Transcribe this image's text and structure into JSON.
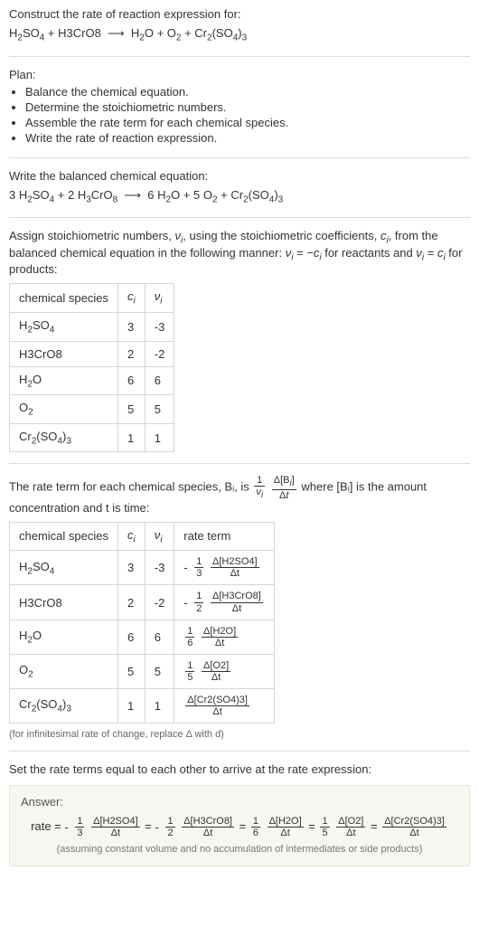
{
  "header": {
    "prompt": "Construct the rate of reaction expression for:",
    "equation": "H₂SO₄ + H3CrO8 ⟶ H₂O + O₂ + Cr₂(SO₄)₃"
  },
  "plan": {
    "title": "Plan:",
    "items": [
      "Balance the chemical equation.",
      "Determine the stoichiometric numbers.",
      "Assemble the rate term for each chemical species.",
      "Write the rate of reaction expression."
    ]
  },
  "balanced": {
    "title": "Write the balanced chemical equation:",
    "equation": "3 H₂SO₄ + 2 H₃CrO₈ ⟶ 6 H₂O + 5 O₂ + Cr₂(SO₄)₃"
  },
  "stoich_text_1": "Assign stoichiometric numbers, νᵢ, using the stoichiometric coefficients, cᵢ, from the balanced chemical equation in the following manner: νᵢ = −cᵢ for reactants and νᵢ = cᵢ for products:",
  "stoich_table": {
    "headers": [
      "chemical species",
      "cᵢ",
      "νᵢ"
    ],
    "rows": [
      {
        "species": "H₂SO₄",
        "c": "3",
        "v": "-3"
      },
      {
        "species": "H3CrO8",
        "c": "2",
        "v": "-2"
      },
      {
        "species": "H₂O",
        "c": "6",
        "v": "6"
      },
      {
        "species": "O₂",
        "c": "5",
        "v": "5"
      },
      {
        "species": "Cr₂(SO₄)₃",
        "c": "1",
        "v": "1"
      }
    ]
  },
  "rate_term_text_pre": "The rate term for each chemical species, Bᵢ, is ",
  "rate_term_text_post": " where [Bᵢ] is the amount concentration and t is time:",
  "rate_table": {
    "headers": [
      "chemical species",
      "cᵢ",
      "νᵢ",
      "rate term"
    ],
    "rows": [
      {
        "species": "H₂SO₄",
        "c": "3",
        "v": "-3",
        "sign": "-",
        "coef_num": "1",
        "coef_den": "3",
        "d_num": "Δ[H2SO4]",
        "d_den": "Δt"
      },
      {
        "species": "H3CrO8",
        "c": "2",
        "v": "-2",
        "sign": "-",
        "coef_num": "1",
        "coef_den": "2",
        "d_num": "Δ[H3CrO8]",
        "d_den": "Δt"
      },
      {
        "species": "H₂O",
        "c": "6",
        "v": "6",
        "sign": "",
        "coef_num": "1",
        "coef_den": "6",
        "d_num": "Δ[H2O]",
        "d_den": "Δt"
      },
      {
        "species": "O₂",
        "c": "5",
        "v": "5",
        "sign": "",
        "coef_num": "1",
        "coef_den": "5",
        "d_num": "Δ[O2]",
        "d_den": "Δt"
      },
      {
        "species": "Cr₂(SO₄)₃",
        "c": "1",
        "v": "1",
        "sign": "",
        "coef_num": "",
        "coef_den": "",
        "d_num": "Δ[Cr2(SO4)3]",
        "d_den": "Δt"
      }
    ],
    "footnote": "(for infinitesimal rate of change, replace Δ with d)"
  },
  "final_text": "Set the rate terms equal to each other to arrive at the rate expression:",
  "answer": {
    "title": "Answer:",
    "prefix": "rate = ",
    "terms": [
      {
        "sign": "-",
        "coef_num": "1",
        "coef_den": "3",
        "d_num": "Δ[H2SO4]",
        "d_den": "Δt"
      },
      {
        "sign": "-",
        "coef_num": "1",
        "coef_den": "2",
        "d_num": "Δ[H3CrO8]",
        "d_den": "Δt"
      },
      {
        "sign": "",
        "coef_num": "1",
        "coef_den": "6",
        "d_num": "Δ[H2O]",
        "d_den": "Δt"
      },
      {
        "sign": "",
        "coef_num": "1",
        "coef_den": "5",
        "d_num": "Δ[O2]",
        "d_den": "Δt"
      },
      {
        "sign": "",
        "coef_num": "",
        "coef_den": "",
        "d_num": "Δ[Cr2(SO4)3]",
        "d_den": "Δt"
      }
    ],
    "note": "(assuming constant volume and no accumulation of intermediates or side products)"
  }
}
